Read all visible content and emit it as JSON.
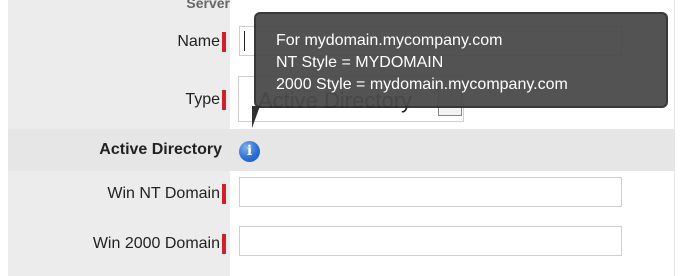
{
  "section_header_partial": "Server",
  "fields": {
    "name": {
      "label": "Name",
      "value": ""
    },
    "type": {
      "label": "Type",
      "value": "Active Directory"
    },
    "win_nt_domain": {
      "label": "Win NT Domain",
      "value": ""
    },
    "win_2000_domain": {
      "label": "Win 2000 Domain",
      "value": ""
    }
  },
  "active_directory_section": {
    "title": "Active Directory",
    "icon": "info-icon"
  },
  "tooltip": {
    "lines": [
      "For mydomain.mycompany.com",
      "NT Style = MYDOMAIN",
      "2000 Style = mydomain.mycompany.com"
    ]
  },
  "colors": {
    "required_marker": "#d1202a",
    "info_icon": "#2d6fd4",
    "tooltip_bg": "#4a4a4a"
  }
}
